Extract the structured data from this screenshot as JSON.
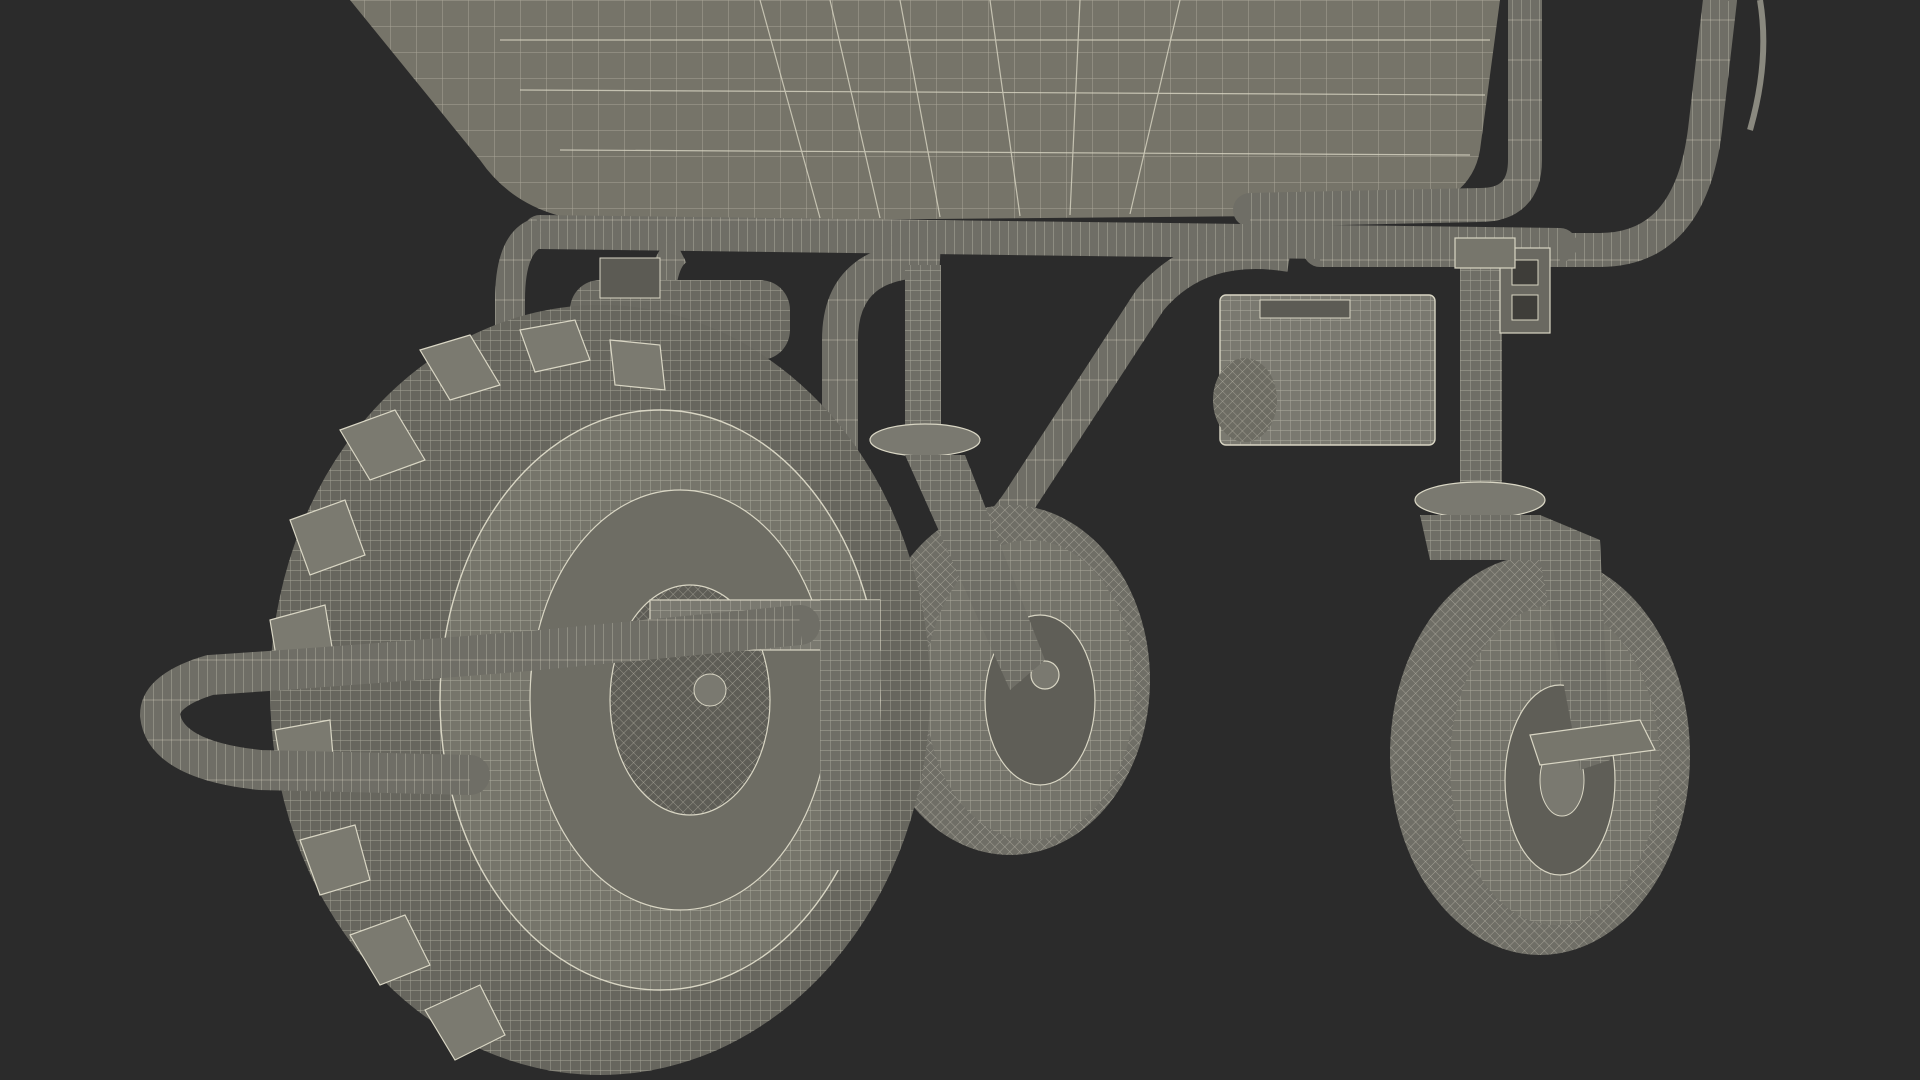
{
  "scene": {
    "subject": "electric-wheelbarrow-wireframe",
    "render_style": "wireframe-over-shaded",
    "colors": {
      "background": "#2b2b2b",
      "surface": "#6f6e66",
      "surface_light": "#8a897f",
      "surface_dark": "#4f4e48",
      "wire": "#d9d6c4"
    },
    "parts": [
      "tub",
      "main-frame",
      "handle-bar",
      "drive-wheel",
      "drive-motor",
      "battery-box",
      "front-caster-wheel",
      "rear-caster-wheel",
      "caster-fork-front",
      "caster-fork-rear",
      "axle-mount-bracket"
    ]
  }
}
